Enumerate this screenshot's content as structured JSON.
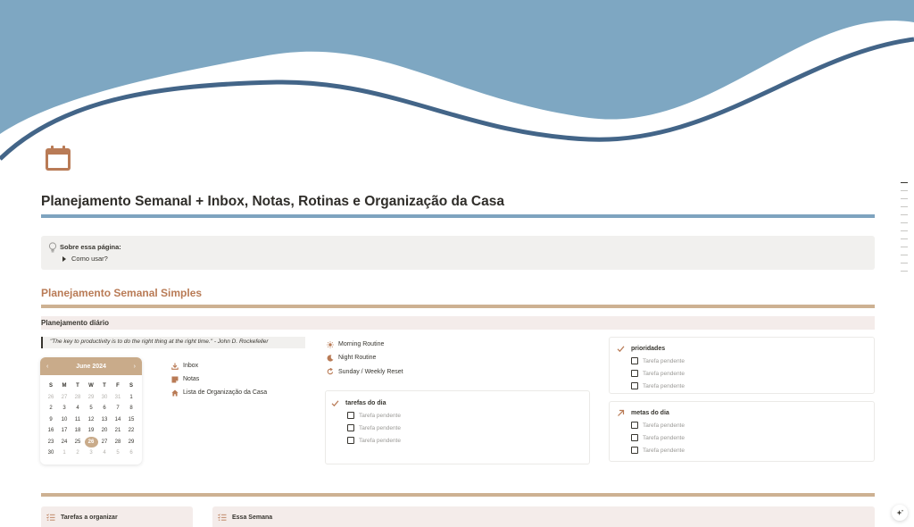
{
  "page": {
    "title": "Planejamento Semanal + Inbox, Notas, Rotinas e Organização da Casa",
    "icon": "calendar-icon",
    "accent_color": "#b97b56",
    "banner_color": "#7ea7c2"
  },
  "callout": {
    "icon": "lightbulb-icon",
    "title": "Sobre essa página:",
    "toggle_label": "Como usar?"
  },
  "section": {
    "title": "Planejamento Semanal Simples",
    "subheader": "Planejamento diário",
    "quote": "\"The key to productivity is to do the right thing at the right time.\" - John D. Rockefeller"
  },
  "calendar": {
    "month_label": "June 2024",
    "prev": "‹",
    "next": "›",
    "weekdays": [
      "S",
      "M",
      "T",
      "W",
      "T",
      "F",
      "S"
    ],
    "days": [
      {
        "d": "26",
        "muted": true
      },
      {
        "d": "27",
        "muted": true
      },
      {
        "d": "28",
        "muted": true
      },
      {
        "d": "29",
        "muted": true
      },
      {
        "d": "30",
        "muted": true
      },
      {
        "d": "31",
        "muted": true
      },
      {
        "d": "1"
      },
      {
        "d": "2"
      },
      {
        "d": "3"
      },
      {
        "d": "4"
      },
      {
        "d": "5"
      },
      {
        "d": "6"
      },
      {
        "d": "7"
      },
      {
        "d": "8"
      },
      {
        "d": "9"
      },
      {
        "d": "10"
      },
      {
        "d": "11"
      },
      {
        "d": "12"
      },
      {
        "d": "13"
      },
      {
        "d": "14"
      },
      {
        "d": "15"
      },
      {
        "d": "16"
      },
      {
        "d": "17"
      },
      {
        "d": "18"
      },
      {
        "d": "19"
      },
      {
        "d": "20"
      },
      {
        "d": "21"
      },
      {
        "d": "22"
      },
      {
        "d": "23"
      },
      {
        "d": "24"
      },
      {
        "d": "25"
      },
      {
        "d": "26",
        "today": true
      },
      {
        "d": "27"
      },
      {
        "d": "28"
      },
      {
        "d": "29"
      },
      {
        "d": "30"
      },
      {
        "d": "1",
        "muted": true
      },
      {
        "d": "2",
        "muted": true
      },
      {
        "d": "3",
        "muted": true
      },
      {
        "d": "4",
        "muted": true
      },
      {
        "d": "5",
        "muted": true
      },
      {
        "d": "6",
        "muted": true
      }
    ]
  },
  "links": [
    {
      "label": "Inbox",
      "icon": "download-icon"
    },
    {
      "label": "Notas",
      "icon": "note-icon"
    },
    {
      "label": "Lista de Organização da Casa",
      "icon": "house-icon"
    }
  ],
  "routines": [
    {
      "label": "Morning Routine",
      "icon": "sun-icon"
    },
    {
      "label": "Night Routine",
      "icon": "moon-icon"
    },
    {
      "label": "Sunday / Weekly Reset",
      "icon": "refresh-icon"
    }
  ],
  "tarefas": {
    "title": "tarefas do dia",
    "items": [
      "Tarefa pendente",
      "Tarefa pendente",
      "Tarefa pendente"
    ]
  },
  "prioridades": {
    "title": "prioridades",
    "items": [
      "Tarefa pendente",
      "Tarefa pendente",
      "Tarefa pendente"
    ]
  },
  "metas": {
    "title": "metas do dia",
    "items": [
      "Tarefa pendente",
      "Tarefa pendente",
      "Tarefa pendente"
    ]
  },
  "boards": {
    "organizar": "Tarefas a organizar",
    "semana": "Essa Semana"
  }
}
